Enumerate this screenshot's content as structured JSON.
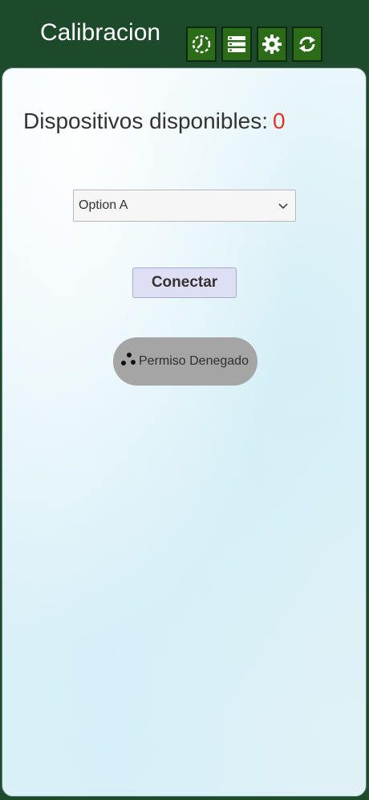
{
  "header": {
    "title": "Calibracion",
    "toolbar": [
      {
        "name": "history",
        "icon": "history-icon"
      },
      {
        "name": "list",
        "icon": "list-icon"
      },
      {
        "name": "settings",
        "icon": "gear-icon"
      },
      {
        "name": "refresh",
        "icon": "refresh-icon"
      }
    ]
  },
  "main": {
    "devices_label": "Dispositivos disponibles:",
    "devices_count": "0",
    "device_select": {
      "selected": "Option A"
    },
    "connect_label": "Conectar",
    "permission_status": "Permiso Denegado"
  },
  "colors": {
    "header_bg": "#1d4a2b",
    "toolbar_button": "#2c6b17",
    "count_color": "#e0332b",
    "connect_button": "#dedff5",
    "status_pill": "#a5a5a5"
  }
}
